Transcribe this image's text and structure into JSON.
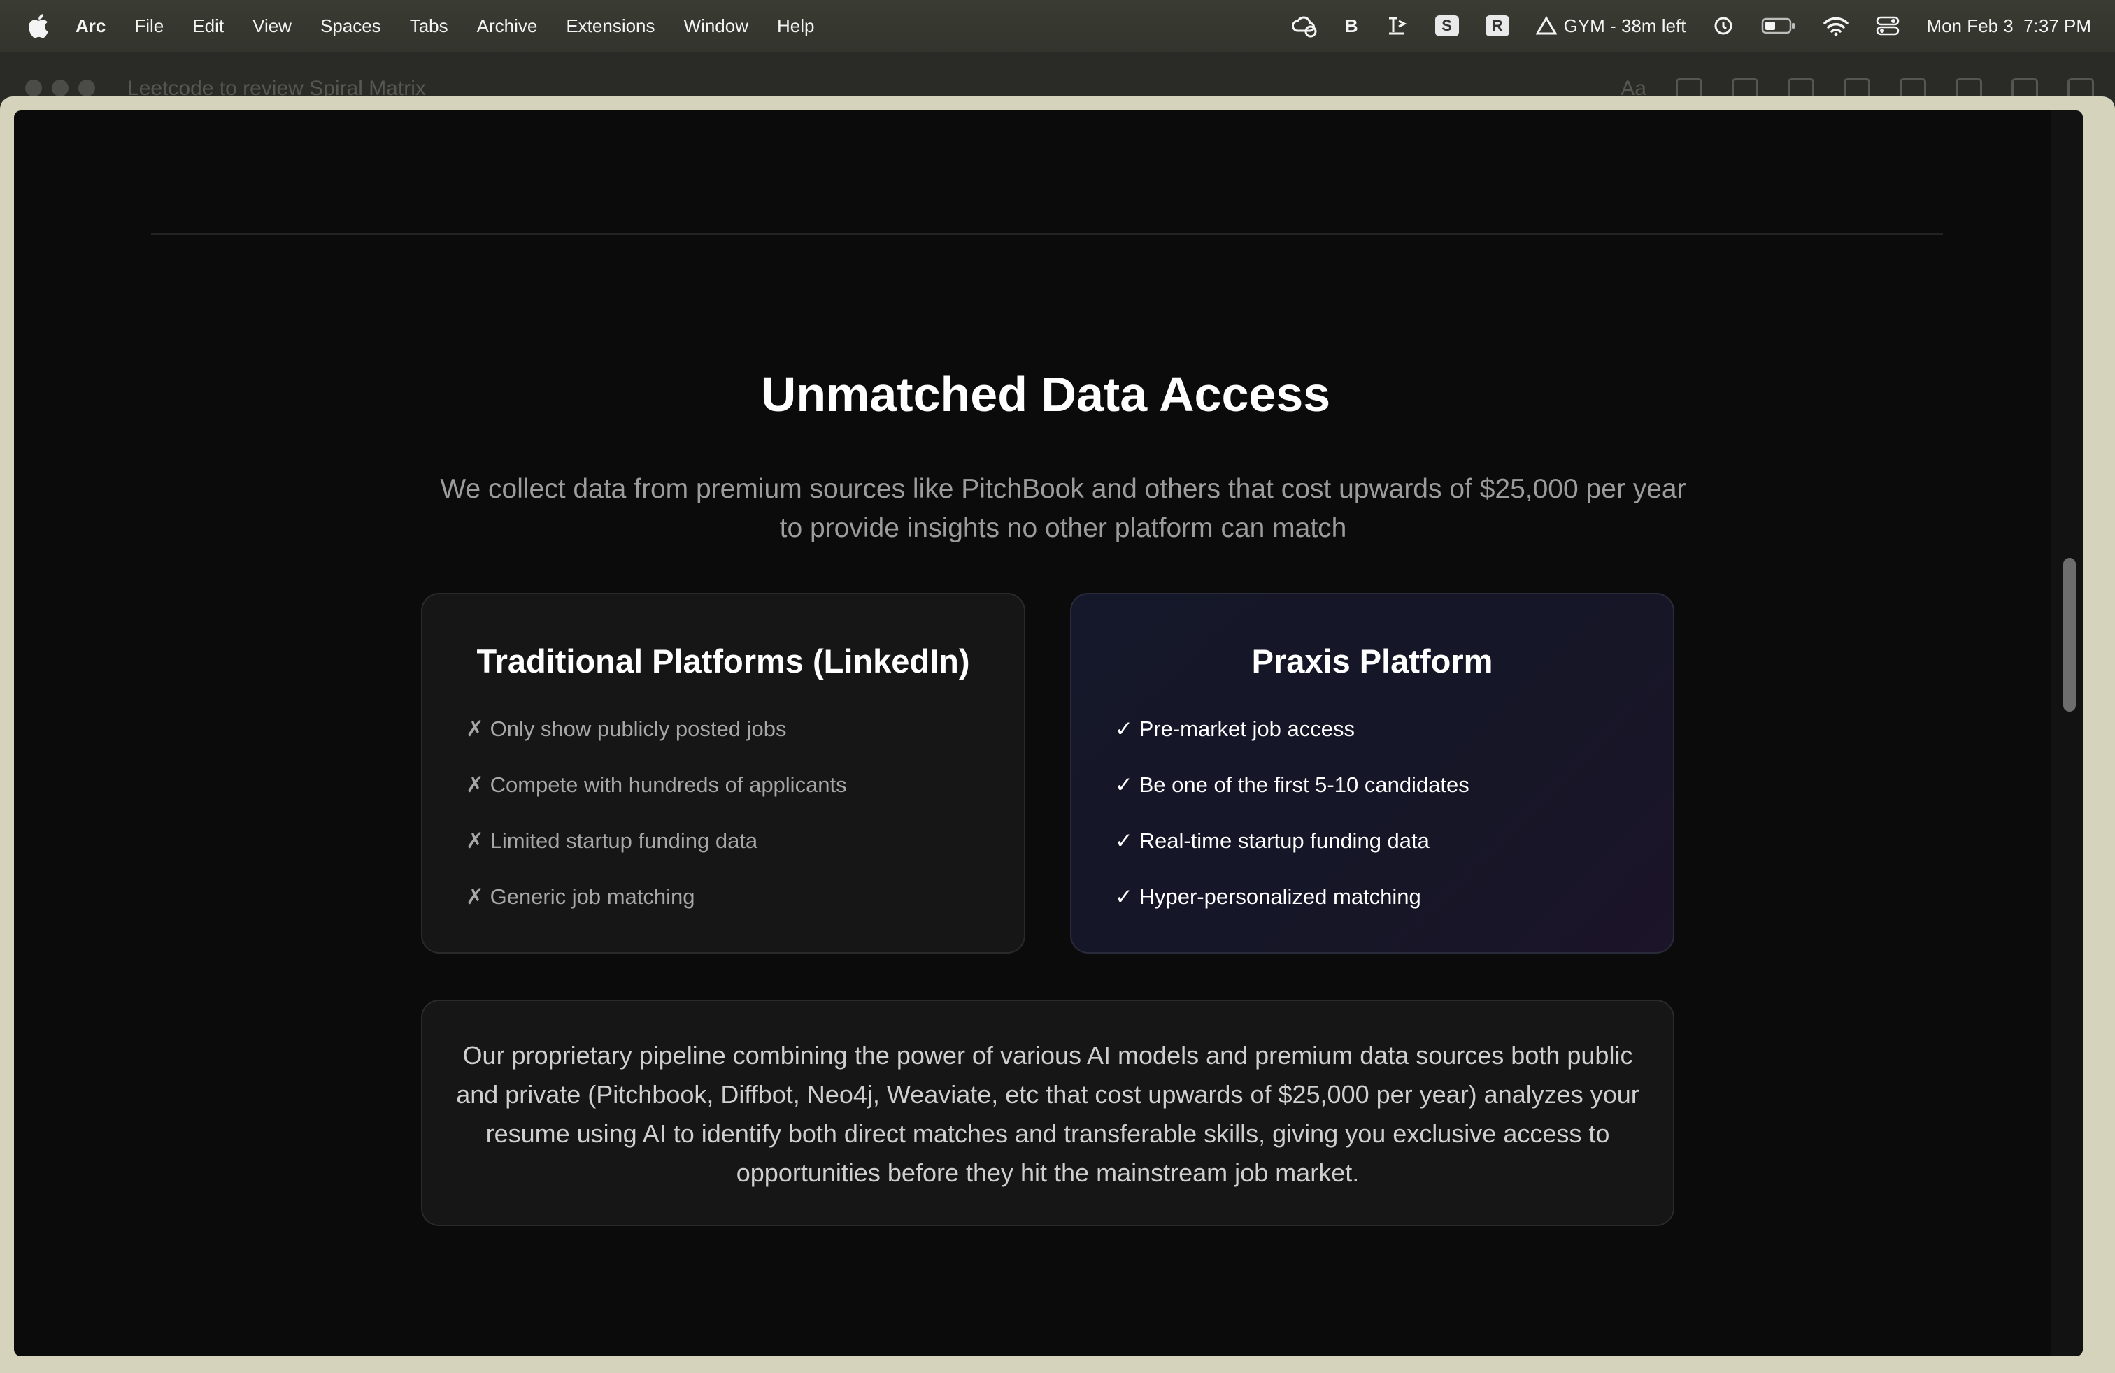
{
  "menubar": {
    "app": "Arc",
    "items": [
      "File",
      "Edit",
      "View",
      "Spaces",
      "Tabs",
      "Archive",
      "Extensions",
      "Window",
      "Help"
    ],
    "status": {
      "b_label": "B",
      "s_label": "S",
      "r_label": "R",
      "timer": "GYM - 38m left",
      "clock": "Mon Feb 3  7:37 PM"
    }
  },
  "background_window": {
    "title": "Leetcode to review Spiral Matrix",
    "font_button": "Aa"
  },
  "page": {
    "title": "Unmatched Data Access",
    "subtitle": "We collect data from premium sources like PitchBook and others that cost upwards of $25,000 per year to provide insights no other platform can match",
    "traditional": {
      "title": "Traditional Platforms (LinkedIn)",
      "items": [
        "✗ Only show publicly posted jobs",
        "✗ Compete with hundreds of applicants",
        "✗ Limited startup funding data",
        "✗ Generic job matching"
      ]
    },
    "praxis": {
      "title": "Praxis Platform",
      "items": [
        "✓ Pre-market job access",
        "✓ Be one of the first 5-10 candidates",
        "✓ Real-time startup funding data",
        "✓ Hyper-personalized matching"
      ]
    },
    "pipeline_text": "Our proprietary pipeline combining the power of various AI models and premium data sources both public and private (Pitchbook, Diffbot, Neo4j, Weaviate, etc that cost upwards of $25,000 per year) analyzes your resume using AI to identify both direct matches and transferable skills, giving you exclusive access to opportunities before they hit the mainstream job market."
  }
}
